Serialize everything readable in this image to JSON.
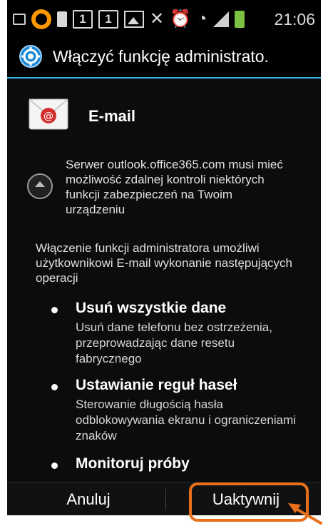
{
  "status_bar": {
    "time": "21:06",
    "icons": [
      "notification-square-icon",
      "orange-ring-icon",
      "sd-card-icon",
      "box-one-icon",
      "box-one-icon",
      "gallery-icon",
      "mute-icon",
      "alarm-icon",
      "wifi-icon",
      "signal-icon",
      "battery-charging-icon"
    ],
    "box_digit": "1",
    "battery_color": "#7dc142"
  },
  "title_bar": {
    "icon": "settings-gear-icon",
    "title": "Włączyć funkcję administrato.",
    "accent_color": "#33b5e5"
  },
  "app": {
    "icon": "email-envelope-icon",
    "name": "E-mail"
  },
  "server_notice": "Serwer outlook.office365.com musi mieć możliwość zdalnej kontroli niektórych funkcji zabezpieczeń na Twoim urządzeniu",
  "description": "Włączenie funkcji administratora umożliwi użytkownikowi E-mail wykonanie następujących operacji",
  "policies": [
    {
      "title": "Usuń wszystkie dane",
      "description": "Usuń dane telefonu bez ostrzeżenia, przeprowadzając dane resetu fabrycznego"
    },
    {
      "title": "Ustawianie reguł haseł",
      "description": "Sterowanie długością hasła odblokowywania ekranu i ograniczeniami znaków"
    },
    {
      "title": "Monitoruj próby",
      "description": ""
    }
  ],
  "buttons": {
    "cancel": "Anuluj",
    "activate": "Uaktywnij"
  },
  "annotation": {
    "highlight_color": "#e8701c"
  }
}
